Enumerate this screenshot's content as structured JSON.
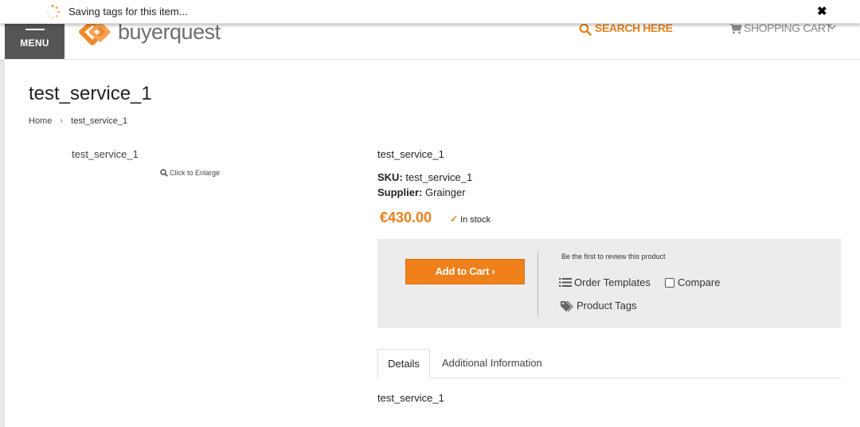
{
  "notification": {
    "text": "Saving tags for this item...",
    "close": "✖"
  },
  "header": {
    "menu_label": "MENU",
    "logo_text": "buyerquest",
    "search_label": "SEARCH HERE",
    "cart_label": "SHOPPING CART"
  },
  "page": {
    "title": "test_service_1",
    "breadcrumb": [
      "Home",
      "test_service_1"
    ]
  },
  "image": {
    "alt_text": "test_service_1",
    "enlarge_label": "Click to Enlarge"
  },
  "product": {
    "name": "test_service_1",
    "sku_label": "SKU:",
    "sku_value": "test_service_1",
    "supplier_label": "Supplier:",
    "supplier_value": "Grainger",
    "price": "€430.00",
    "stock": "In stock"
  },
  "actions": {
    "add_to_cart": "Add to Cart ›",
    "review": "Be the first to review this product",
    "order_templates": "Order Templates",
    "compare": "Compare",
    "product_tags": "Product Tags"
  },
  "tabs": [
    {
      "label": "Details",
      "active": true
    },
    {
      "label": "Additional Information",
      "active": false
    }
  ],
  "tab_content": "test_service_1",
  "colors": {
    "accent": "#e8801c",
    "button": "#f0801a",
    "menu_bg": "#555555",
    "panel_bg": "#ececec"
  }
}
